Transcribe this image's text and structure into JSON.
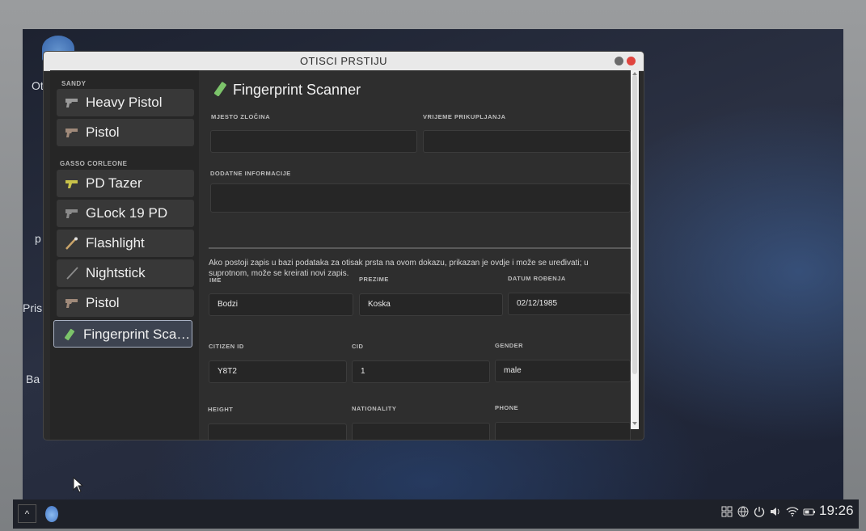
{
  "window": {
    "title": "OTISCI PRSTIJU"
  },
  "desktop": {
    "labels": [
      "Ot",
      "p",
      "Pris",
      "Ba"
    ]
  },
  "sidebar": {
    "sections": [
      {
        "label": "SANDY",
        "items": [
          {
            "label": "Heavy Pistol",
            "icon": "pistol-icon"
          },
          {
            "label": "Pistol",
            "icon": "pistol-icon"
          }
        ]
      },
      {
        "label": "GASSO CORLEONE",
        "items": [
          {
            "label": "PD Tazer",
            "icon": "tazer-icon"
          },
          {
            "label": "GLock 19 PD",
            "icon": "pistol-icon"
          },
          {
            "label": "Flashlight",
            "icon": "flashlight-icon"
          },
          {
            "label": "Nightstick",
            "icon": "nightstick-icon"
          },
          {
            "label": "Pistol",
            "icon": "pistol-icon"
          },
          {
            "label": "Fingerprint Sca…",
            "icon": "fingerprint-scanner-icon",
            "active": true
          }
        ]
      }
    ]
  },
  "main": {
    "title": "Fingerprint Scanner",
    "crime_scene_label": "MJESTO ZLOČINA",
    "crime_scene_value": "",
    "collection_time_label": "VRIJEME PRIKUPLJANJA",
    "collection_time_value": "",
    "additional_info_label": "DODATNE INFORMACIJE",
    "additional_info_value": "",
    "info_text": "Ako postoji zapis u bazi podataka za otisak prsta na ovom dokazu, prikazan je ovdje i može se uređivati; u suprotnom, može se kreirati novi zapis.",
    "first_name_label": "IME",
    "first_name_value": "Bodzi",
    "last_name_label": "PREZIME",
    "last_name_value": "Koska",
    "dob_label": "DATUM ROĐENJA",
    "dob_value": "02/12/1985",
    "citizen_id_label": "CITIZEN ID",
    "citizen_id_value": "Y8T2",
    "cid_label": "CID",
    "cid_value": "1",
    "gender_label": "GENDER",
    "gender_value": "male",
    "height_label": "HEIGHT",
    "nationality_label": "NATIONALITY",
    "phone_label": "PHONE"
  },
  "taskbar": {
    "expand_label": "^",
    "clock": "19:26"
  }
}
